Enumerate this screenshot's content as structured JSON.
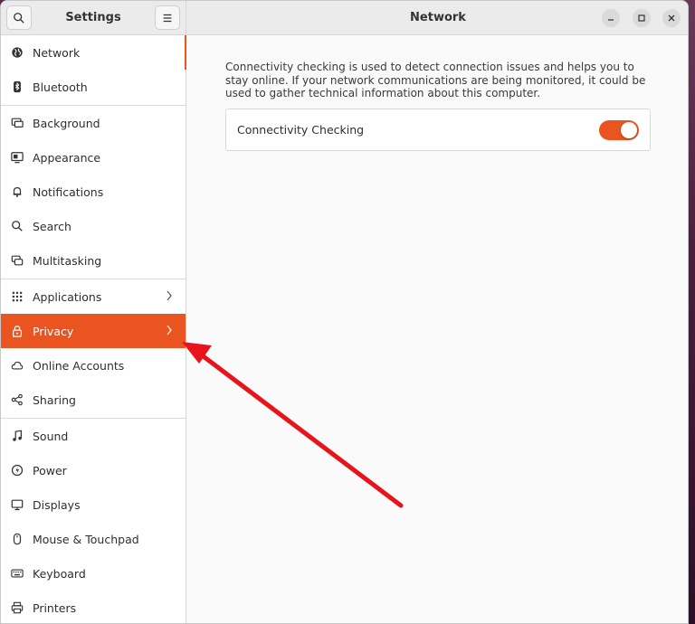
{
  "sidebar_header": {
    "title": "Settings"
  },
  "main_header": {
    "title": "Network"
  },
  "sidebar": {
    "items": [
      {
        "id": "network",
        "label": "Network",
        "icon": "globe-icon"
      },
      {
        "id": "bluetooth",
        "label": "Bluetooth",
        "icon": "bluetooth-icon"
      },
      {
        "id": "background",
        "label": "Background",
        "icon": "monitor-icon"
      },
      {
        "id": "appearance",
        "label": "Appearance",
        "icon": "appearance-icon"
      },
      {
        "id": "notifications",
        "label": "Notifications",
        "icon": "bell-icon"
      },
      {
        "id": "search",
        "label": "Search",
        "icon": "search-icon"
      },
      {
        "id": "multitasking",
        "label": "Multitasking",
        "icon": "multitasking-icon"
      },
      {
        "id": "applications",
        "label": "Applications",
        "icon": "grid-icon"
      },
      {
        "id": "privacy",
        "label": "Privacy",
        "icon": "lock-icon"
      },
      {
        "id": "online-accounts",
        "label": "Online Accounts",
        "icon": "cloud-icon"
      },
      {
        "id": "sharing",
        "label": "Sharing",
        "icon": "share-icon"
      },
      {
        "id": "sound",
        "label": "Sound",
        "icon": "music-note-icon"
      },
      {
        "id": "power",
        "label": "Power",
        "icon": "power-icon"
      },
      {
        "id": "displays",
        "label": "Displays",
        "icon": "display-icon"
      },
      {
        "id": "mouse-touchpad",
        "label": "Mouse & Touchpad",
        "icon": "mouse-icon"
      },
      {
        "id": "keyboard",
        "label": "Keyboard",
        "icon": "keyboard-icon"
      },
      {
        "id": "printers",
        "label": "Printers",
        "icon": "printer-icon"
      }
    ],
    "selected": "privacy",
    "active_page": "network"
  },
  "main": {
    "description": "Connectivity checking is used to detect connection issues and helps you to stay online. If your network communications are being monitored, it could be used to gather technical information about this computer.",
    "connectivity": {
      "label": "Connectivity Checking",
      "enabled": true
    }
  },
  "colors": {
    "accent": "#e95420",
    "annotation_arrow": "#e8141b"
  }
}
